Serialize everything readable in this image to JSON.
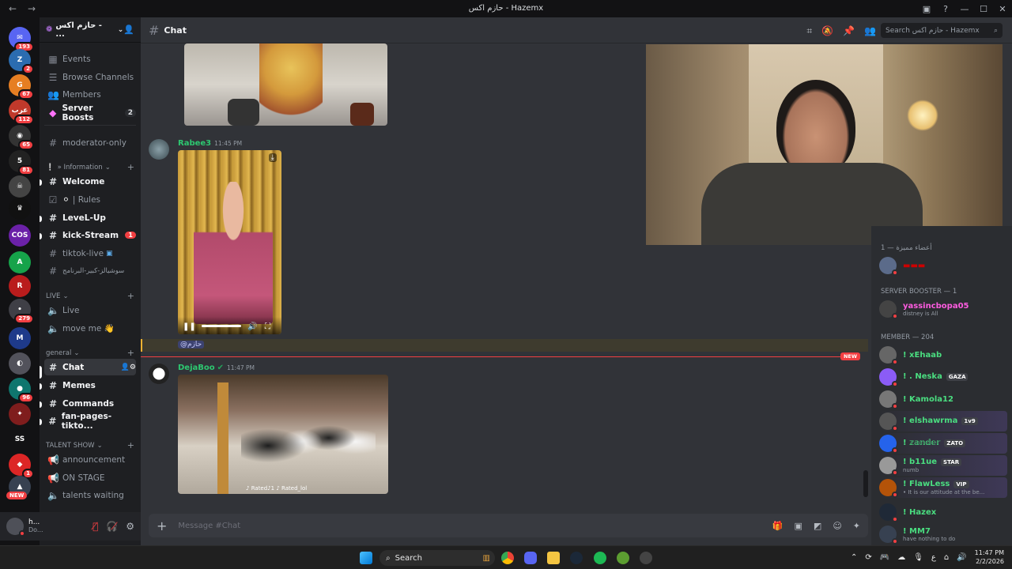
{
  "window": {
    "title": "حازم اكس - Hazemx",
    "back": "←",
    "forward": "→"
  },
  "guilds": [
    {
      "label": "✉",
      "badge": "193",
      "color": "#5865f2"
    },
    {
      "label": "Z",
      "badge": "2",
      "color": "#2b6cb0"
    },
    {
      "label": "G",
      "badge": "67",
      "color": "#e67e22"
    },
    {
      "label": "عرب",
      "badge": "112",
      "color": "#c0392b"
    },
    {
      "label": "◉",
      "badge": "65",
      "color": "#333"
    },
    {
      "label": "5",
      "badge": "81",
      "color": "#222"
    },
    {
      "label": "☠",
      "badge": "",
      "color": "#444"
    },
    {
      "label": "♛",
      "badge": "",
      "color": "#111"
    },
    {
      "label": "COS",
      "badge": "",
      "color": "#6b21a8"
    },
    {
      "label": "A",
      "badge": "",
      "color": "#16a34a"
    },
    {
      "label": "R",
      "badge": "",
      "color": "#b91c1c"
    },
    {
      "label": "•",
      "badge": "279",
      "color": "#3f3f46"
    },
    {
      "label": "M",
      "badge": "",
      "color": "#1e3a8a"
    },
    {
      "label": "◐",
      "badge": "",
      "color": "#52525b"
    },
    {
      "label": "●",
      "badge": "96",
      "color": "#0f766e"
    },
    {
      "label": "✦",
      "badge": "",
      "color": "#7f1d1d"
    },
    {
      "label": "SS",
      "badge": "",
      "color": "#121214"
    },
    {
      "label": "◆",
      "badge": "1",
      "color": "#dc2626"
    },
    {
      "label": "▲",
      "badge": "",
      "color": "#374151"
    }
  ],
  "guild_new": "NEW",
  "server": {
    "name": "حازم اكس - ...",
    "chevron": "⌄"
  },
  "channels": {
    "events": "Events",
    "browse": "Browse Channels",
    "members": "Members",
    "boosts": "Server Boosts",
    "boosts_count": "2",
    "moderator": "moderator-only",
    "cat_information": "» Information",
    "welcome": "Welcome",
    "rules": "| Rules",
    "level": "LeveL-Up",
    "kick": "kick-Stream",
    "kick_count": "1",
    "tiktok": "tiktok-live",
    "arabic": "سوشيالز-كبير-البرنامج",
    "cat_live": "LIVE",
    "live": "Live",
    "moveme": "move me 👋",
    "cat_general": "general",
    "chat": "Chat",
    "memes": "Memes",
    "commands": "Commands",
    "fanpages": "fan-pages-tikto...",
    "cat_talent": "TALENT SHOW",
    "announcement": "announcement",
    "onstage": "ON STAGE",
    "talents": "talents waiting"
  },
  "user": {
    "name": "h...",
    "status": "Do..."
  },
  "header": {
    "channel": "Chat",
    "search_placeholder": "Search حازم اكس - Hazemx"
  },
  "messages": [
    {
      "author": "Rabee3",
      "time": "11:45 PM",
      "color": "#2dc770"
    },
    {
      "author": "DejaBoo",
      "time": "11:47 PM",
      "color": "#2dc770"
    }
  ],
  "mention": "@حازم",
  "new_badge": "NEW",
  "video_caption": "♪ Rated♪1 ♪ Rated_lol",
  "composer": {
    "placeholder": "Message #Chat"
  },
  "member_categories": {
    "special": "أعضاء مميزة — 1",
    "booster": "SERVER BOOSTER — 1",
    "member": "MEMBER — 204"
  },
  "members": [
    {
      "name": "yassincbopa05",
      "sub": "distney is All",
      "color": "#ff5ce1",
      "tag": "",
      "av": "#444"
    },
    {
      "name": "! xEhaab",
      "sub": "",
      "color": "#4ade80",
      "tag": "",
      "av": "#666"
    },
    {
      "name": "! . Neska",
      "sub": "",
      "color": "#4ade80",
      "tag": "GAZA",
      "av": "#8b5cf6"
    },
    {
      "name": "! Kamola12",
      "sub": "",
      "color": "#4ade80",
      "tag": "",
      "av": "#777"
    },
    {
      "name": "! elshawrma",
      "sub": "",
      "color": "#4ade80",
      "tag": "1v9",
      "av": "#555"
    },
    {
      "name": "! 𝕫𝕒𝕟𝕕𝕖𝕣",
      "sub": "",
      "color": "#4ade80",
      "tag": "ZATO",
      "av": "#2563eb"
    },
    {
      "name": "! b11ue",
      "sub": "numb",
      "color": "#4ade80",
      "tag": "STAR",
      "av": "#999"
    },
    {
      "name": "! FlawLess",
      "sub": "• It is our attitude at the be...",
      "color": "#4ade80",
      "tag": "VIP",
      "av": "#b45309"
    },
    {
      "name": "! Hazex",
      "sub": "",
      "color": "#4ade80",
      "tag": "",
      "av": "#1f2937"
    },
    {
      "name": "! MM7",
      "sub": "have nothing to do",
      "color": "#4ade80",
      "tag": "",
      "av": "#374151"
    }
  ],
  "taskbar": {
    "search": "Search",
    "time": "11:47 PM",
    "date": "2/2/2026",
    "lang": "ع"
  }
}
